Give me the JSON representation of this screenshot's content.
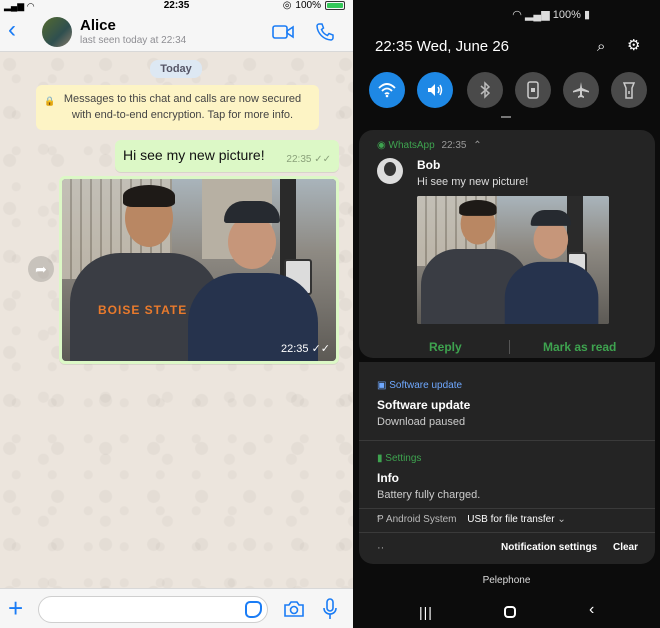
{
  "ios": {
    "status": {
      "time": "22:35",
      "battery": "100%"
    },
    "header": {
      "back": "‹",
      "contact_name": "Alice",
      "last_seen": "last seen today at 22:34"
    },
    "day_label": "Today",
    "encryption_notice": "Messages to this chat and calls are now secured with end-to-end encryption. Tap for more info.",
    "messages": [
      {
        "text": "Hi see my new picture!",
        "time": "22:35"
      },
      {
        "type": "photo",
        "time": "22:35",
        "shirt_text": "BOISE STATE"
      }
    ],
    "input": {
      "placeholder": ""
    }
  },
  "android": {
    "status": "100%",
    "time": "22:35",
    "date": "Wed, June 26",
    "quick_settings": [
      "wifi",
      "sound",
      "bluetooth",
      "portrait-lock",
      "airplane",
      "flashlight"
    ],
    "whatsapp": {
      "app": "WhatsApp",
      "time": "22:35",
      "sender": "Bob",
      "text": "Hi see my new picture!",
      "reply": "Reply",
      "mark_read": "Mark as read"
    },
    "software": {
      "app": "Software update",
      "title": "Software update",
      "sub": "Download paused"
    },
    "settings": {
      "app": "Settings",
      "title": "Info",
      "sub": "Battery fully charged."
    },
    "system": {
      "app": "Android System",
      "text": "USB for file transfer"
    },
    "footer": {
      "dots": "··",
      "notification_settings": "Notification settings",
      "clear": "Clear"
    },
    "carrier": "Pelephone"
  },
  "colors": {
    "ios_blue": "#1a7cf5",
    "bubble_out": "#dcf8c6",
    "whatsapp_green": "#3ea34f",
    "qs_on": "#1e88e5"
  }
}
